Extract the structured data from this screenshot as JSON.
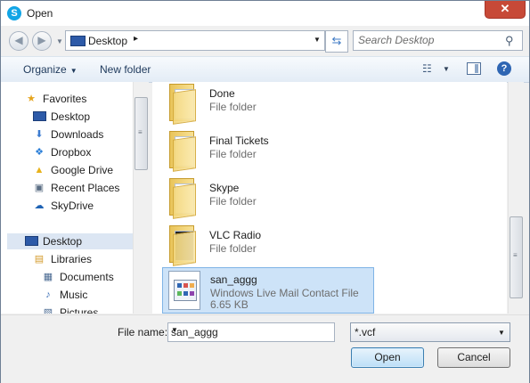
{
  "window": {
    "title": "Open",
    "close_glyph": "✕",
    "app_icon": "skype-icon"
  },
  "address": {
    "location": "Desktop",
    "separator": "▸"
  },
  "search": {
    "placeholder": "Search Desktop"
  },
  "toolbar": {
    "organize": "Organize",
    "new_folder": "New folder"
  },
  "sidebar": {
    "items": [
      {
        "label": "Favorites",
        "icon": "star-icon"
      },
      {
        "label": "Desktop",
        "icon": "desktop-icon"
      },
      {
        "label": "Downloads",
        "icon": "downloads-icon"
      },
      {
        "label": "Dropbox",
        "icon": "dropbox-icon"
      },
      {
        "label": "Google Drive",
        "icon": "google-drive-icon"
      },
      {
        "label": "Recent Places",
        "icon": "recent-places-icon"
      },
      {
        "label": "SkyDrive",
        "icon": "skydrive-icon"
      },
      {
        "label": "Desktop",
        "icon": "desktop-icon"
      },
      {
        "label": "Libraries",
        "icon": "libraries-icon"
      },
      {
        "label": "Documents",
        "icon": "documents-icon"
      },
      {
        "label": "Music",
        "icon": "music-icon"
      },
      {
        "label": "Pictures",
        "icon": "pictures-icon"
      }
    ]
  },
  "files": [
    {
      "name": "Done",
      "type": "File folder"
    },
    {
      "name": "Final Tickets",
      "type": "File folder"
    },
    {
      "name": "Skype",
      "type": "File folder"
    },
    {
      "name": "VLC Radio",
      "type": "File folder"
    },
    {
      "name": "san_aggg",
      "type": "Windows Live Mail Contact File",
      "size": "6.65 KB"
    }
  ],
  "bottom": {
    "file_name_label": "File name:",
    "file_name_value": "san_aggg",
    "filter": "*.vcf",
    "open": "Open",
    "cancel": "Cancel"
  },
  "colors": {
    "selection": "#cde3f8",
    "accent": "#2f66b3"
  }
}
